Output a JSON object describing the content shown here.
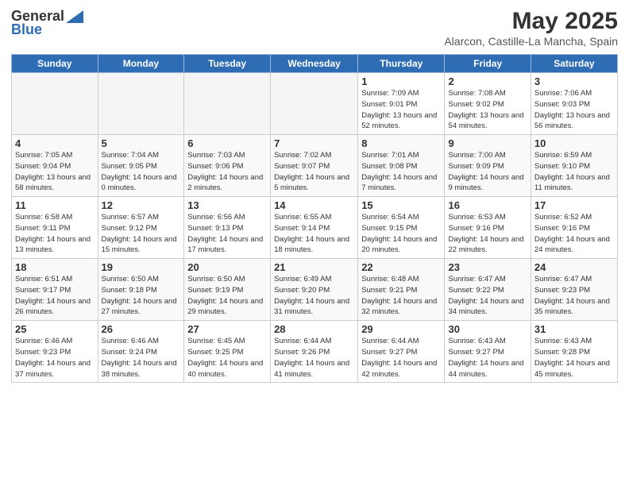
{
  "logo": {
    "general": "General",
    "blue": "Blue"
  },
  "title": {
    "month": "May 2025",
    "location": "Alarcon, Castille-La Mancha, Spain"
  },
  "days_of_week": [
    "Sunday",
    "Monday",
    "Tuesday",
    "Wednesday",
    "Thursday",
    "Friday",
    "Saturday"
  ],
  "weeks": [
    [
      {
        "day": "",
        "info": ""
      },
      {
        "day": "",
        "info": ""
      },
      {
        "day": "",
        "info": ""
      },
      {
        "day": "",
        "info": ""
      },
      {
        "day": "1",
        "sunrise": "Sunrise: 7:09 AM",
        "sunset": "Sunset: 9:01 PM",
        "daylight": "Daylight: 13 hours and 52 minutes."
      },
      {
        "day": "2",
        "sunrise": "Sunrise: 7:08 AM",
        "sunset": "Sunset: 9:02 PM",
        "daylight": "Daylight: 13 hours and 54 minutes."
      },
      {
        "day": "3",
        "sunrise": "Sunrise: 7:06 AM",
        "sunset": "Sunset: 9:03 PM",
        "daylight": "Daylight: 13 hours and 56 minutes."
      }
    ],
    [
      {
        "day": "4",
        "sunrise": "Sunrise: 7:05 AM",
        "sunset": "Sunset: 9:04 PM",
        "daylight": "Daylight: 13 hours and 58 minutes."
      },
      {
        "day": "5",
        "sunrise": "Sunrise: 7:04 AM",
        "sunset": "Sunset: 9:05 PM",
        "daylight": "Daylight: 14 hours and 0 minutes."
      },
      {
        "day": "6",
        "sunrise": "Sunrise: 7:03 AM",
        "sunset": "Sunset: 9:06 PM",
        "daylight": "Daylight: 14 hours and 2 minutes."
      },
      {
        "day": "7",
        "sunrise": "Sunrise: 7:02 AM",
        "sunset": "Sunset: 9:07 PM",
        "daylight": "Daylight: 14 hours and 5 minutes."
      },
      {
        "day": "8",
        "sunrise": "Sunrise: 7:01 AM",
        "sunset": "Sunset: 9:08 PM",
        "daylight": "Daylight: 14 hours and 7 minutes."
      },
      {
        "day": "9",
        "sunrise": "Sunrise: 7:00 AM",
        "sunset": "Sunset: 9:09 PM",
        "daylight": "Daylight: 14 hours and 9 minutes."
      },
      {
        "day": "10",
        "sunrise": "Sunrise: 6:59 AM",
        "sunset": "Sunset: 9:10 PM",
        "daylight": "Daylight: 14 hours and 11 minutes."
      }
    ],
    [
      {
        "day": "11",
        "sunrise": "Sunrise: 6:58 AM",
        "sunset": "Sunset: 9:11 PM",
        "daylight": "Daylight: 14 hours and 13 minutes."
      },
      {
        "day": "12",
        "sunrise": "Sunrise: 6:57 AM",
        "sunset": "Sunset: 9:12 PM",
        "daylight": "Daylight: 14 hours and 15 minutes."
      },
      {
        "day": "13",
        "sunrise": "Sunrise: 6:56 AM",
        "sunset": "Sunset: 9:13 PM",
        "daylight": "Daylight: 14 hours and 17 minutes."
      },
      {
        "day": "14",
        "sunrise": "Sunrise: 6:55 AM",
        "sunset": "Sunset: 9:14 PM",
        "daylight": "Daylight: 14 hours and 18 minutes."
      },
      {
        "day": "15",
        "sunrise": "Sunrise: 6:54 AM",
        "sunset": "Sunset: 9:15 PM",
        "daylight": "Daylight: 14 hours and 20 minutes."
      },
      {
        "day": "16",
        "sunrise": "Sunrise: 6:53 AM",
        "sunset": "Sunset: 9:16 PM",
        "daylight": "Daylight: 14 hours and 22 minutes."
      },
      {
        "day": "17",
        "sunrise": "Sunrise: 6:52 AM",
        "sunset": "Sunset: 9:16 PM",
        "daylight": "Daylight: 14 hours and 24 minutes."
      }
    ],
    [
      {
        "day": "18",
        "sunrise": "Sunrise: 6:51 AM",
        "sunset": "Sunset: 9:17 PM",
        "daylight": "Daylight: 14 hours and 26 minutes."
      },
      {
        "day": "19",
        "sunrise": "Sunrise: 6:50 AM",
        "sunset": "Sunset: 9:18 PM",
        "daylight": "Daylight: 14 hours and 27 minutes."
      },
      {
        "day": "20",
        "sunrise": "Sunrise: 6:50 AM",
        "sunset": "Sunset: 9:19 PM",
        "daylight": "Daylight: 14 hours and 29 minutes."
      },
      {
        "day": "21",
        "sunrise": "Sunrise: 6:49 AM",
        "sunset": "Sunset: 9:20 PM",
        "daylight": "Daylight: 14 hours and 31 minutes."
      },
      {
        "day": "22",
        "sunrise": "Sunrise: 6:48 AM",
        "sunset": "Sunset: 9:21 PM",
        "daylight": "Daylight: 14 hours and 32 minutes."
      },
      {
        "day": "23",
        "sunrise": "Sunrise: 6:47 AM",
        "sunset": "Sunset: 9:22 PM",
        "daylight": "Daylight: 14 hours and 34 minutes."
      },
      {
        "day": "24",
        "sunrise": "Sunrise: 6:47 AM",
        "sunset": "Sunset: 9:23 PM",
        "daylight": "Daylight: 14 hours and 35 minutes."
      }
    ],
    [
      {
        "day": "25",
        "sunrise": "Sunrise: 6:46 AM",
        "sunset": "Sunset: 9:23 PM",
        "daylight": "Daylight: 14 hours and 37 minutes."
      },
      {
        "day": "26",
        "sunrise": "Sunrise: 6:46 AM",
        "sunset": "Sunset: 9:24 PM",
        "daylight": "Daylight: 14 hours and 38 minutes."
      },
      {
        "day": "27",
        "sunrise": "Sunrise: 6:45 AM",
        "sunset": "Sunset: 9:25 PM",
        "daylight": "Daylight: 14 hours and 40 minutes."
      },
      {
        "day": "28",
        "sunrise": "Sunrise: 6:44 AM",
        "sunset": "Sunset: 9:26 PM",
        "daylight": "Daylight: 14 hours and 41 minutes."
      },
      {
        "day": "29",
        "sunrise": "Sunrise: 6:44 AM",
        "sunset": "Sunset: 9:27 PM",
        "daylight": "Daylight: 14 hours and 42 minutes."
      },
      {
        "day": "30",
        "sunrise": "Sunrise: 6:43 AM",
        "sunset": "Sunset: 9:27 PM",
        "daylight": "Daylight: 14 hours and 44 minutes."
      },
      {
        "day": "31",
        "sunrise": "Sunrise: 6:43 AM",
        "sunset": "Sunset: 9:28 PM",
        "daylight": "Daylight: 14 hours and 45 minutes."
      }
    ]
  ]
}
